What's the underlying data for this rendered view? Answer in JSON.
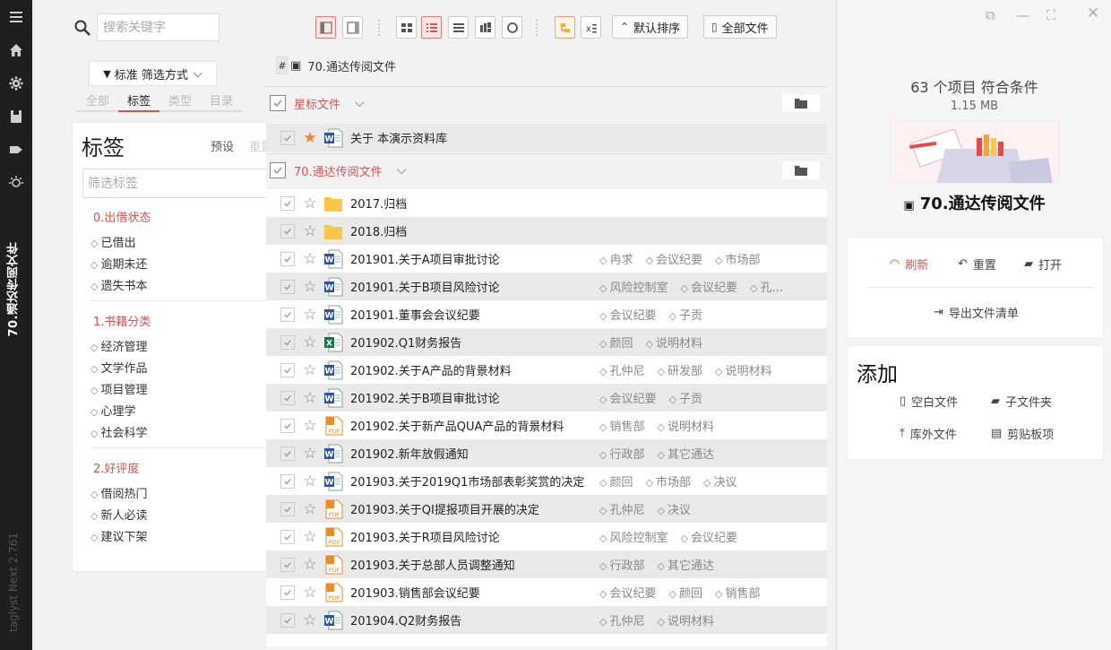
{
  "app": {
    "sidebar_title": "70.通达传阅文件",
    "version": "taglyst Next 2.761"
  },
  "rail_icons": [
    "menu-icon",
    "home-icon",
    "settings-icon",
    "library-icon",
    "tag-icon",
    "bulb-icon"
  ],
  "filter": {
    "search_placeholder": "搜索关键字",
    "mode_label": "标准 筛选方式",
    "tabs": [
      {
        "label": "全部",
        "active": false
      },
      {
        "label": "标签",
        "active": true
      },
      {
        "label": "类型",
        "active": false
      },
      {
        "label": "目录",
        "active": false
      }
    ],
    "card_title": "标签",
    "preset": "预设",
    "reset": "重置",
    "tag_filter_placeholder": "筛选标签",
    "groups": [
      {
        "name": "0.出借状态",
        "tags": [
          "已借出",
          "逾期未还",
          "遗失书本"
        ]
      },
      {
        "name": "1.书籍分类",
        "tags": [
          "经济管理",
          "文学作品",
          "项目管理",
          "心理学",
          "社会科学"
        ]
      },
      {
        "name": "2.好评度",
        "tags": [
          "借阅热门",
          "新人必读",
          "建议下架"
        ]
      }
    ]
  },
  "toolbar": {
    "sort_label": "默认排序",
    "scope_label": "全部文件"
  },
  "breadcrumb": {
    "path": "70.通达传阅文件"
  },
  "sections": [
    {
      "label": "星标文件"
    },
    {
      "label": "70.通达传阅文件"
    }
  ],
  "starred_files": [
    {
      "name": "关于 本演示资料库",
      "type": "word",
      "starred": true,
      "tags": []
    }
  ],
  "files": [
    {
      "name": "2017.归档",
      "type": "folder",
      "tags": []
    },
    {
      "name": "2018.归档",
      "type": "folder",
      "tags": []
    },
    {
      "name": "201901.关于A项目审批讨论",
      "type": "word",
      "tags": [
        "冉求",
        "会议纪要",
        "市场部"
      ]
    },
    {
      "name": "201901.关于B项目风险讨论",
      "type": "word",
      "tags": [
        "风险控制室",
        "会议纪要",
        "孔..."
      ]
    },
    {
      "name": "201901.董事会会议纪要",
      "type": "word",
      "tags": [
        "会议纪要",
        "子贡"
      ]
    },
    {
      "name": "201902.Q1财务报告",
      "type": "excel",
      "tags": [
        "颜回",
        "说明材料"
      ]
    },
    {
      "name": "201902.关于A产品的背景材料",
      "type": "word",
      "tags": [
        "孔仲尼",
        "研发部",
        "说明材料"
      ]
    },
    {
      "name": "201902.关于B项目审批讨论",
      "type": "word",
      "tags": [
        "会议纪要",
        "子贡"
      ]
    },
    {
      "name": "201902.关于新产品QUA产品的背景材料",
      "type": "pdf",
      "tags": [
        "销售部",
        "说明材料"
      ]
    },
    {
      "name": "201902.新年放假通知",
      "type": "word",
      "tags": [
        "行政部",
        "其它通达"
      ]
    },
    {
      "name": "201903.关于2019Q1市场部表彰奖赏的决定",
      "type": "word",
      "tags": [
        "颜回",
        "市场部",
        "决议"
      ]
    },
    {
      "name": "201903.关于QI提报项目开展的决定",
      "type": "pdf",
      "tags": [
        "孔仲尼",
        "决议"
      ]
    },
    {
      "name": "201903.关于R项目风险讨论",
      "type": "pdf",
      "tags": [
        "风险控制室",
        "会议纪要"
      ]
    },
    {
      "name": "201903.关于总部人员调整通知",
      "type": "pdf",
      "tags": [
        "行政部",
        "其它通达"
      ]
    },
    {
      "name": "201903.销售部会议纪要",
      "type": "pdf",
      "tags": [
        "会议纪要",
        "颜回",
        "销售部"
      ]
    },
    {
      "name": "201904.Q2财务报告",
      "type": "word",
      "tags": [
        "孔仲尼",
        "说明材料"
      ]
    }
  ],
  "detail": {
    "count_text": "63 个项目 符合条件",
    "size_text": "1.15 MB",
    "folder_title": "70.通达传阅文件",
    "refresh": "刷新",
    "reset": "重置",
    "open": "打开",
    "export": "导出文件清单",
    "add_title": "添加",
    "blank_file": "空白文件",
    "subfolder": "子文件夹",
    "external_file": "库外文件",
    "clipboard": "剪贴板项"
  },
  "colors": {
    "accent": "#d9534f",
    "star": "#e8872c",
    "word": "#2b5797",
    "excel": "#1e7145",
    "pdf": "#f08a24",
    "folder": "#f8c74a"
  }
}
